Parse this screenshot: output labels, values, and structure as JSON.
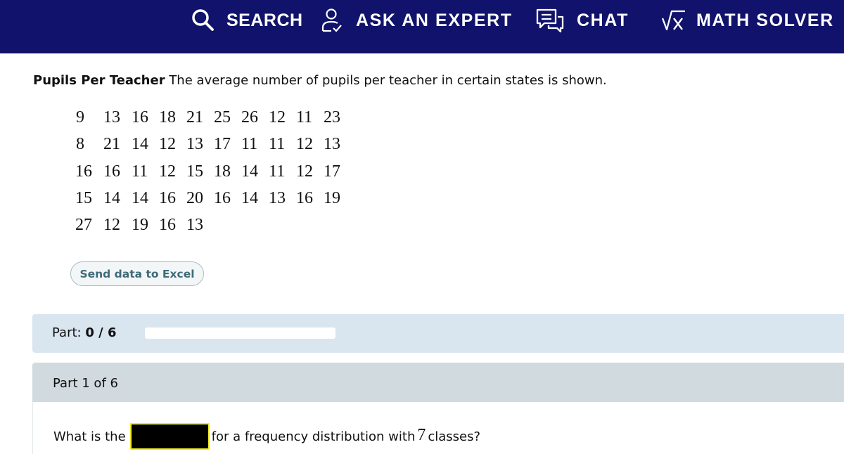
{
  "nav": {
    "items": [
      {
        "label": "SEARCH",
        "icon": "search-icon"
      },
      {
        "label": "ASK AN EXPERT",
        "icon": "person-check-icon"
      },
      {
        "label": "CHAT",
        "icon": "chat-bubbles-icon"
      },
      {
        "label": "MATH SOLVER",
        "icon": "square-root-x-icon"
      }
    ],
    "background": "#10126b"
  },
  "problem": {
    "title": "Pupils Per Teacher",
    "description": "The average number of pupils per teacher in certain states is shown.",
    "data_rows": [
      [
        "9",
        "13",
        "16",
        "18",
        "21",
        "25",
        "26",
        "12",
        "11",
        "23"
      ],
      [
        "8",
        "21",
        "14",
        "12",
        "13",
        "17",
        "11",
        "11",
        "12",
        "13"
      ],
      [
        "16",
        "16",
        "11",
        "12",
        "15",
        "18",
        "14",
        "11",
        "12",
        "17"
      ],
      [
        "15",
        "14",
        "14",
        "16",
        "20",
        "16",
        "14",
        "13",
        "16",
        "19"
      ],
      [
        "27",
        "12",
        "19",
        "16",
        "13"
      ]
    ],
    "excel_button": "Send data to Excel"
  },
  "progress": {
    "label": "Part:",
    "value": "0 / 6",
    "completed": 0,
    "total": 6
  },
  "part": {
    "title": "Part 1 of 6",
    "question_prefix": "What is the",
    "question_suffix_a": "for a frequency distribution with",
    "classes": "7",
    "question_suffix_b": "classes?"
  }
}
